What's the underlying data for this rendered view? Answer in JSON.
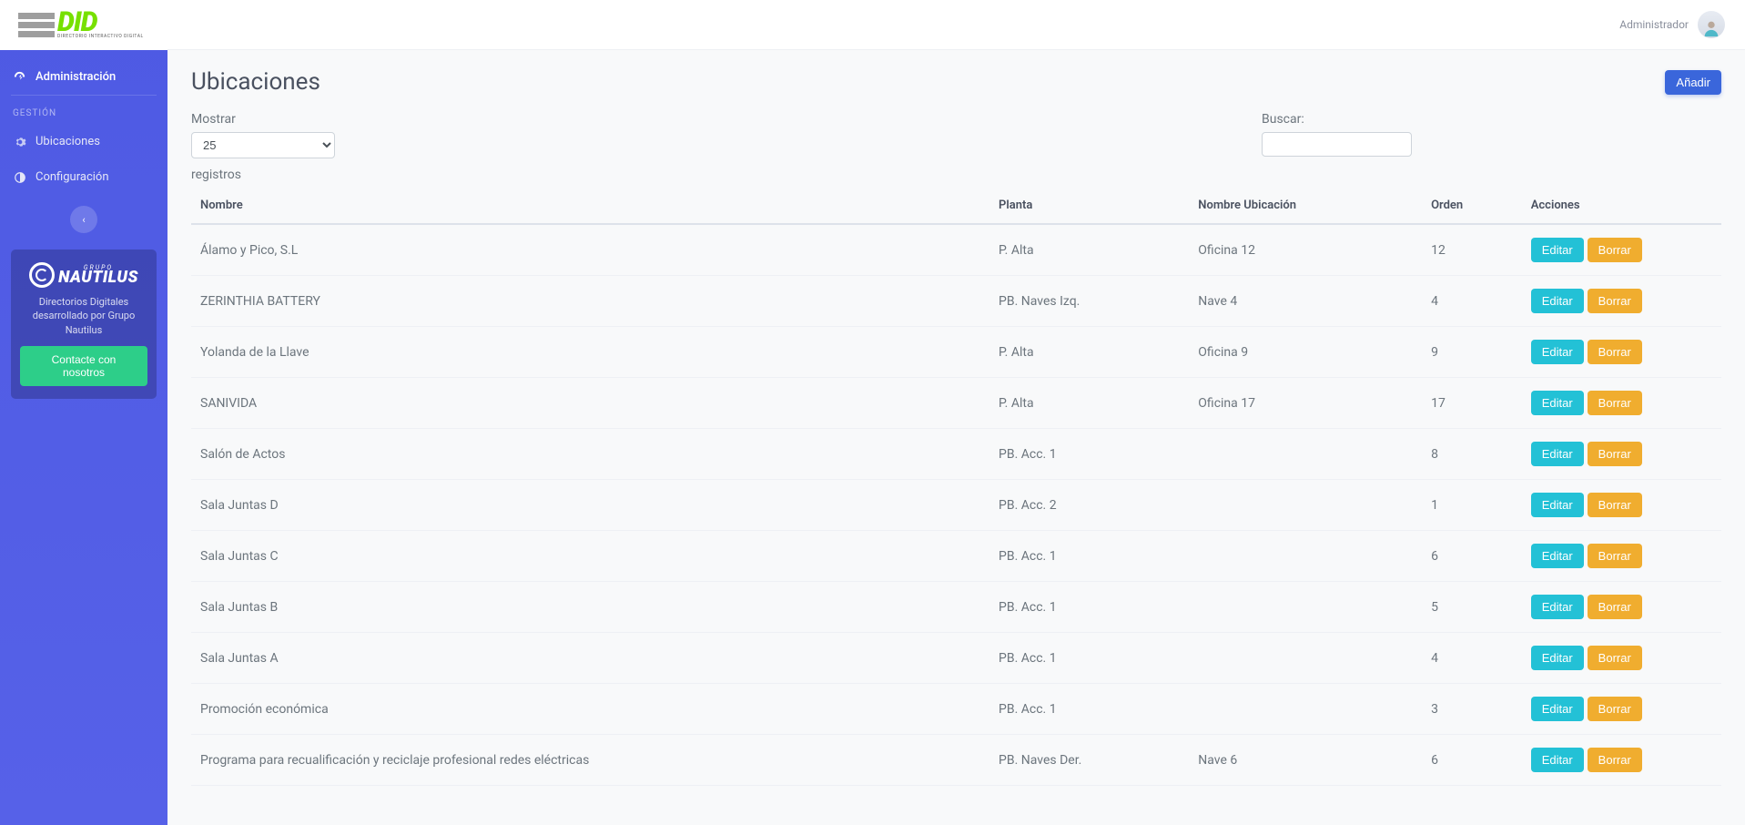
{
  "brand": {
    "logo_text": "DID",
    "logo_sub": "DIRECTORIO INTERACTIVO DIGITAL"
  },
  "sidebar": {
    "admin_label": "Administración",
    "section_label": "GESTIÓN",
    "items": [
      {
        "label": "Ubicaciones"
      },
      {
        "label": "Configuración"
      }
    ],
    "promo": {
      "grupo": "GRUPO",
      "brand": "NAUTILUS",
      "desc": "Directorios Digitales desarrollado por Grupo Nautilus",
      "cta": "Contacte con nosotros"
    }
  },
  "topbar": {
    "user_label": "Administrador"
  },
  "page": {
    "title": "Ubicaciones",
    "add_button": "Añadir",
    "show_label": "Mostrar",
    "per_page": "25",
    "records_label": "registros",
    "search_label": "Buscar:",
    "search_value": "",
    "columns": {
      "nombre": "Nombre",
      "planta": "Planta",
      "nombre_ubicacion": "Nombre Ubicación",
      "orden": "Orden",
      "acciones": "Acciones"
    },
    "actions": {
      "edit": "Editar",
      "delete": "Borrar"
    },
    "rows": [
      {
        "nombre": "Álamo y Pico, S.L",
        "planta": "P. Alta",
        "nombre_ubicacion": "Oficina 12",
        "orden": "12"
      },
      {
        "nombre": "ZERINTHIA BATTERY",
        "planta": "PB. Naves Izq.",
        "nombre_ubicacion": "Nave 4",
        "orden": "4"
      },
      {
        "nombre": "Yolanda de la Llave",
        "planta": "P. Alta",
        "nombre_ubicacion": "Oficina 9",
        "orden": "9"
      },
      {
        "nombre": "SANIVIDA",
        "planta": "P. Alta",
        "nombre_ubicacion": "Oficina 17",
        "orden": "17"
      },
      {
        "nombre": "Salón de Actos",
        "planta": "PB. Acc. 1",
        "nombre_ubicacion": "",
        "orden": "8"
      },
      {
        "nombre": "Sala Juntas D",
        "planta": "PB. Acc. 2",
        "nombre_ubicacion": "",
        "orden": "1"
      },
      {
        "nombre": "Sala Juntas C",
        "planta": "PB. Acc. 1",
        "nombre_ubicacion": "",
        "orden": "6"
      },
      {
        "nombre": "Sala Juntas B",
        "planta": "PB. Acc. 1",
        "nombre_ubicacion": "",
        "orden": "5"
      },
      {
        "nombre": "Sala Juntas A",
        "planta": "PB. Acc. 1",
        "nombre_ubicacion": "",
        "orden": "4"
      },
      {
        "nombre": "Promoción económica",
        "planta": "PB. Acc. 1",
        "nombre_ubicacion": "",
        "orden": "3"
      },
      {
        "nombre": "Programa para recualificación y reciclaje profesional redes eléctricas",
        "planta": "PB. Naves Der.",
        "nombre_ubicacion": "Nave 6",
        "orden": "6"
      }
    ]
  }
}
